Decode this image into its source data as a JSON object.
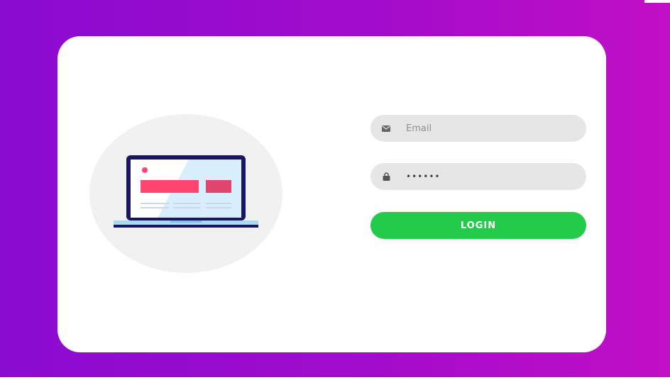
{
  "login_form": {
    "email": {
      "placeholder": "Email",
      "value": "",
      "icon": "envelope-icon"
    },
    "password": {
      "placeholder": "",
      "value": "••••••",
      "icon": "lock-icon"
    },
    "login_label": "LOGIN"
  },
  "illustration": {
    "icon": "laptop-illustration"
  },
  "colors": {
    "background_gradient_start": "#8a0bd0",
    "background_gradient_end": "#c10fc6",
    "card": "#ffffff",
    "input_background": "#e6e6e6",
    "login_button": "#22cc4a",
    "laptop_frame": "#1b1560",
    "laptop_accent": "#ff4570"
  }
}
